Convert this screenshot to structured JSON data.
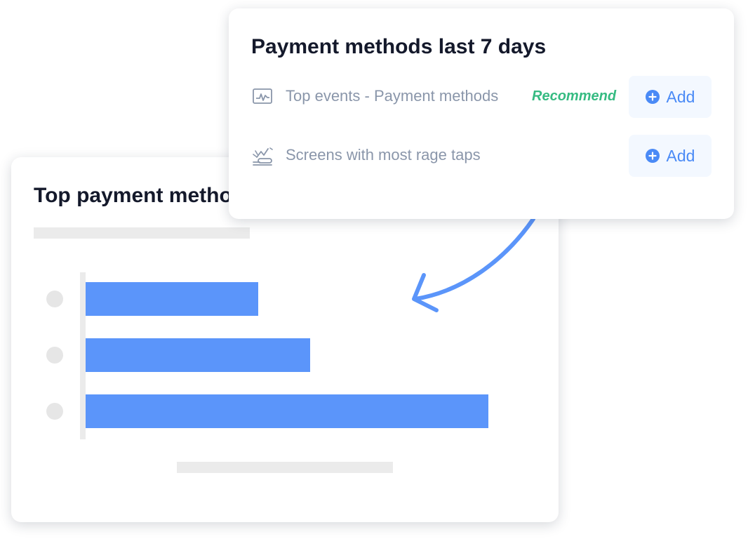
{
  "chart_card": {
    "title": "Top payment metho"
  },
  "chart_data": {
    "type": "bar",
    "orientation": "horizontal",
    "categories": [
      "",
      "",
      ""
    ],
    "values": [
      246,
      320,
      574
    ],
    "xlim": [
      0,
      600
    ],
    "grid": false,
    "color": "#5b95fa"
  },
  "popup": {
    "title": "Payment methods last 7 days",
    "items": [
      {
        "icon": "line-chart-icon",
        "label": "Top events - Payment methods",
        "badge": "Recommend",
        "button_label": "Add"
      },
      {
        "icon": "rage-tap-icon",
        "label": "Screens with most rage taps",
        "badge": "",
        "button_label": "Add"
      }
    ]
  },
  "colors": {
    "accent": "#5b95fa",
    "button_text": "#4a8af6",
    "recommend": "#36bb82",
    "title_text": "#14192b",
    "muted_text": "#8a96aa",
    "placeholder": "#ebebeb"
  }
}
